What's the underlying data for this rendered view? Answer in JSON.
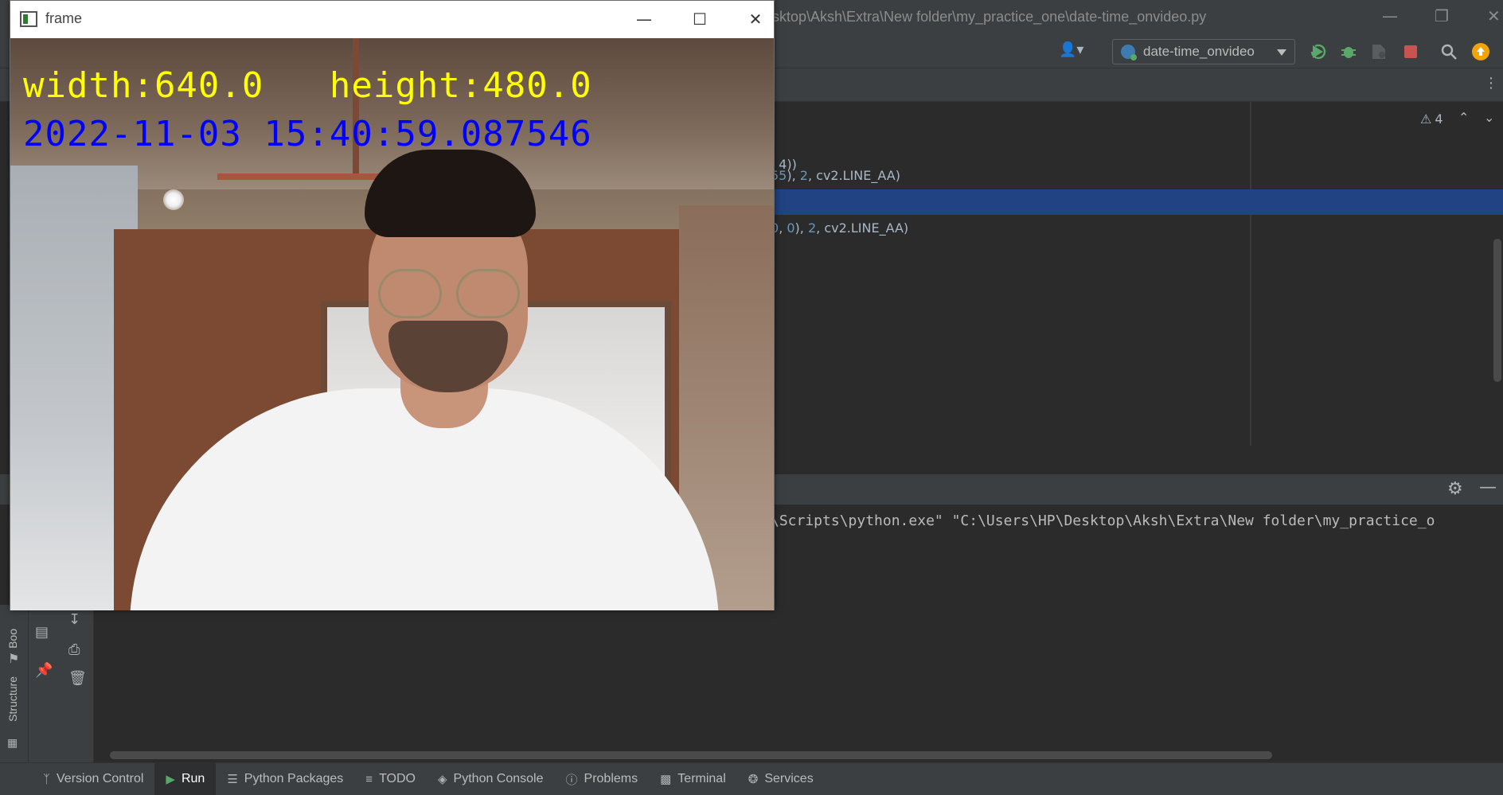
{
  "ide": {
    "window_title": "sktop\\Aksh\\Extra\\New folder\\my_practice_one\\date-time_onvideo.py",
    "run_config": "date-time_onvideo",
    "warnings_count": "4",
    "code_lines": [
      {
        "text": "4))"
      },
      {
        "text_num": "55",
        "text_rest": "), ",
        "n2": "2",
        "rest2": ", cv2.LINE_AA)"
      },
      {
        "text": ""
      },
      {
        "n1": "0",
        "sep": ", ",
        "n2": "0",
        "mid": "), ",
        "n3": "2",
        "rest": ", cv2.LINE_AA)"
      }
    ],
    "console_line": "\\Scripts\\python.exe\" \"C:\\Users\\HP\\Desktop\\Aksh\\Extra\\New folder\\my_practice_o",
    "left_strip_labels": [
      "Boo",
      "Structure"
    ]
  },
  "bottom_bar": {
    "tabs": [
      {
        "label": "Version Control",
        "icon": "branch-icon"
      },
      {
        "label": "Run",
        "icon": "play-icon"
      },
      {
        "label": "Python Packages",
        "icon": "layers-icon"
      },
      {
        "label": "TODO",
        "icon": "list-icon"
      },
      {
        "label": "Python Console",
        "icon": "python-icon"
      },
      {
        "label": "Problems",
        "icon": "alert-circle-icon"
      },
      {
        "label": "Terminal",
        "icon": "terminal-icon"
      },
      {
        "label": "Services",
        "icon": "services-icon"
      }
    ]
  },
  "frame_window": {
    "title": "frame",
    "overlay_size": "width:640.0   height:480.0",
    "overlay_datetime": "2022-11-03 15:40:59.087546",
    "overlay_size_color": "#ffff00",
    "overlay_datetime_color": "#0000ff"
  },
  "colors": {
    "ide_bg": "#2b2b2b",
    "ide_panel": "#3c3f41",
    "selection": "#214283",
    "run_green": "#59a869",
    "stop_red": "#c75450",
    "update_orange": "#f0a30a"
  }
}
